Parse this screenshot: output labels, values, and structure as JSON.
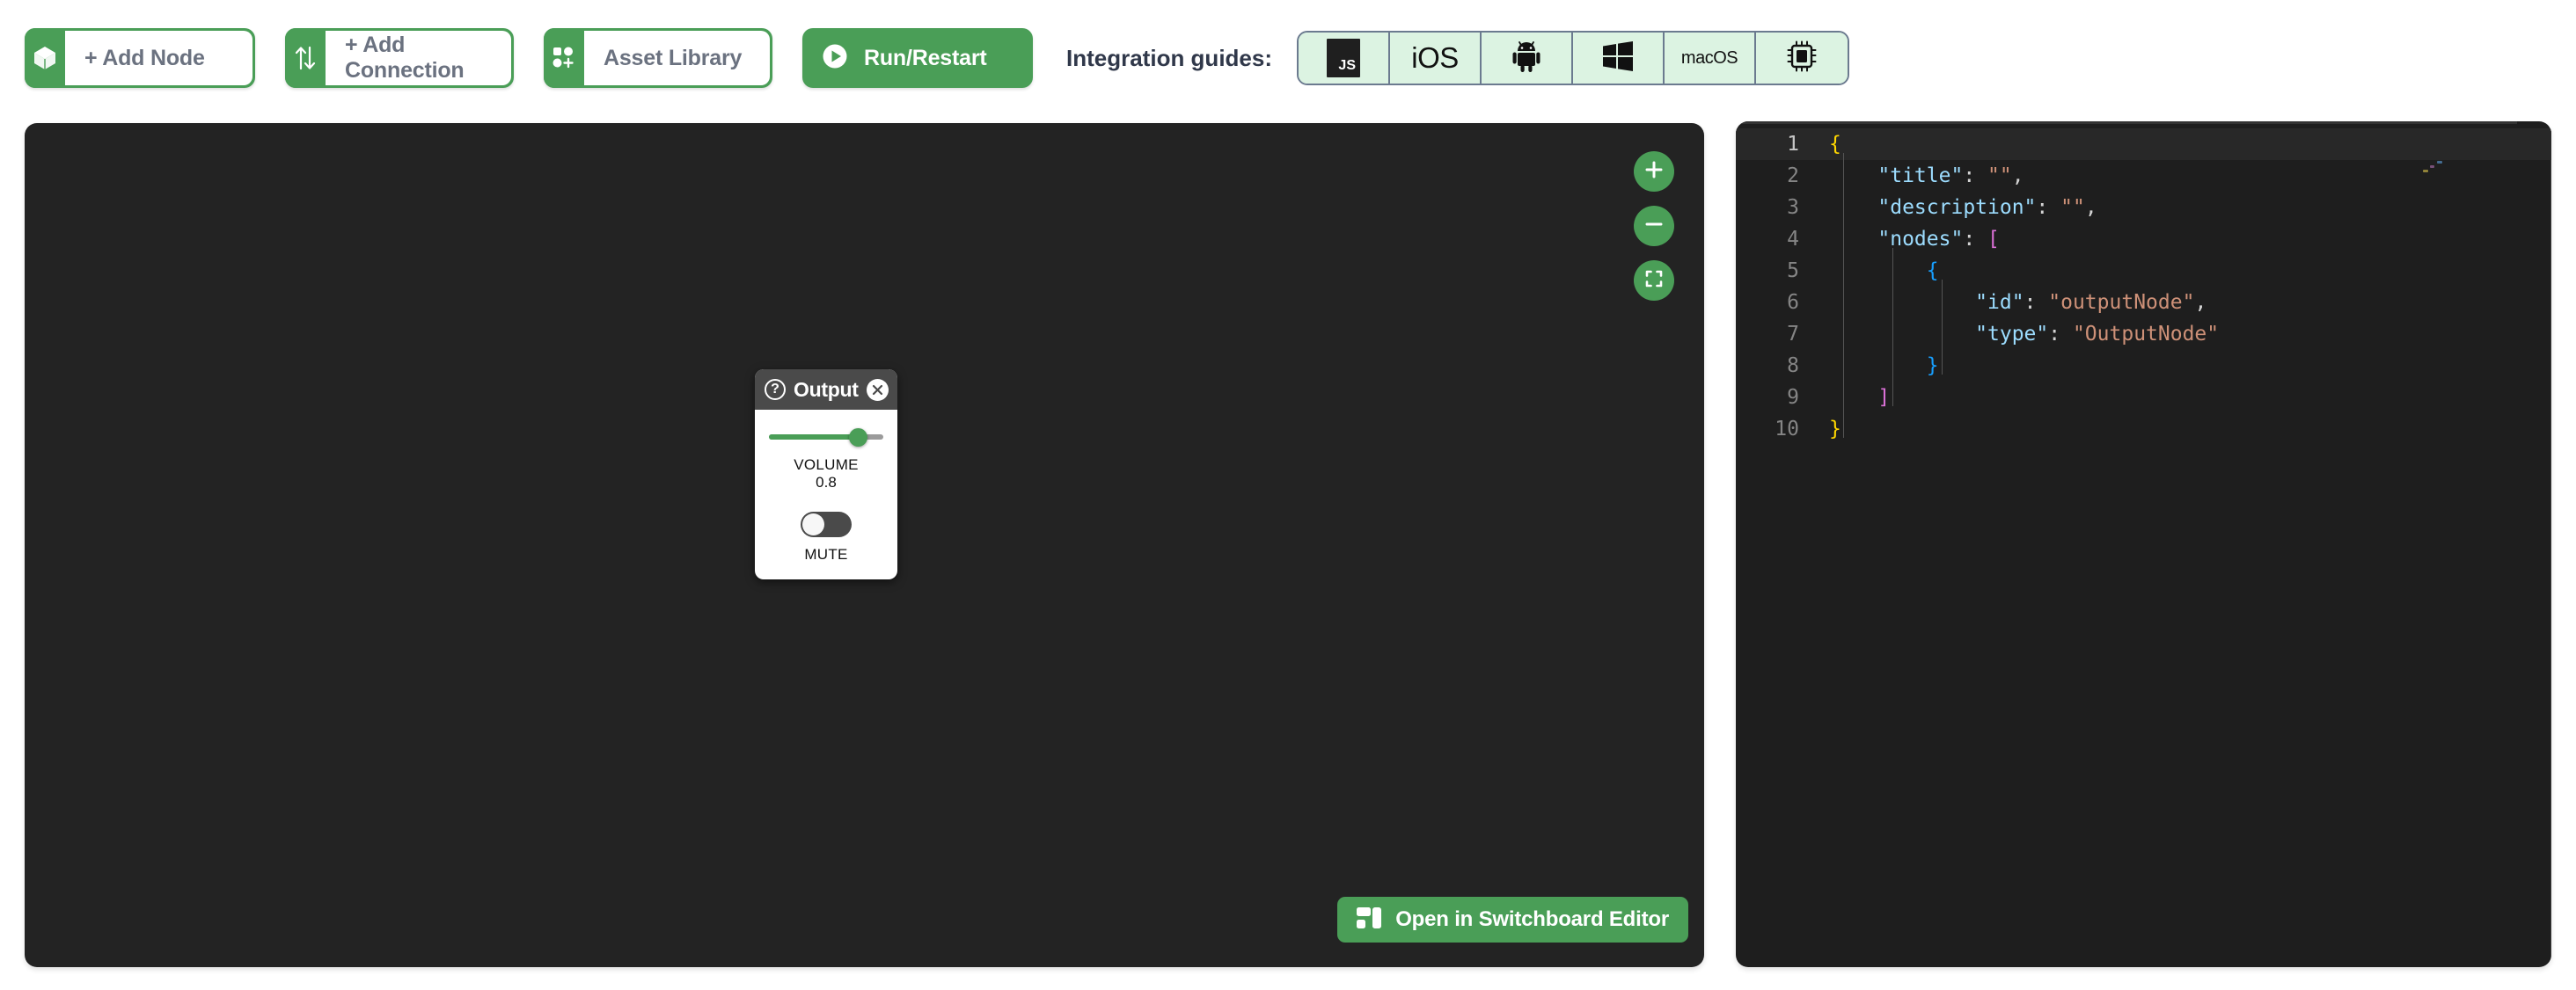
{
  "toolbar": {
    "buttons": [
      {
        "id": "add-node",
        "icon": "cube-icon",
        "label": "+ Add Node"
      },
      {
        "id": "add-connection",
        "icon": "arrows-updown-icon",
        "label": "+ Add Connection"
      },
      {
        "id": "asset-library",
        "icon": "grid-plus-icon",
        "label": "Asset Library"
      }
    ],
    "run": {
      "icon": "play-icon",
      "label": "Run/Restart"
    },
    "integration": {
      "label": "Integration guides:",
      "items": [
        {
          "id": "js",
          "type": "js-box",
          "text": "JS",
          "icon": "javascript-icon"
        },
        {
          "id": "ios",
          "type": "text",
          "text": "iOS",
          "icon": "ios-icon"
        },
        {
          "id": "android",
          "type": "glyph",
          "text": "🤖",
          "icon": "android-icon"
        },
        {
          "id": "windows",
          "type": "glyph",
          "text": "",
          "icon": "windows-icon"
        },
        {
          "id": "macos",
          "type": "text-sm",
          "text": "macOS",
          "icon": "macos-icon"
        },
        {
          "id": "embedded",
          "type": "glyph",
          "text": "",
          "icon": "cpu-chip-icon"
        }
      ]
    }
  },
  "canvas": {
    "zoom_controls": [
      {
        "id": "zoom-in",
        "icon": "plus-icon",
        "label": "+"
      },
      {
        "id": "zoom-out",
        "icon": "minus-icon",
        "label": "−"
      },
      {
        "id": "fit-view",
        "icon": "fit-frame-icon",
        "label": ""
      }
    ],
    "node": {
      "title": "Output",
      "help_icon": "question-mark-icon",
      "help_glyph": "?",
      "close_icon": "close-x-icon",
      "volume": {
        "label": "VOLUME",
        "value": "0.8",
        "fill_percent": 78
      },
      "mute": {
        "label": "MUTE",
        "state": "off"
      }
    },
    "editor_button": {
      "icon": "layout-panels-icon",
      "label": "Open in Switchboard Editor"
    }
  },
  "code_panel": {
    "language": "json",
    "active_line": 1,
    "lines": [
      {
        "n": "1",
        "tokens": [
          {
            "t": "{",
            "c": "t-brace-y"
          }
        ]
      },
      {
        "n": "2",
        "tokens": [
          {
            "t": "    \"title\"",
            "c": "t-key"
          },
          {
            "t": ": ",
            "c": "t-punc"
          },
          {
            "t": "\"\"",
            "c": "t-str"
          },
          {
            "t": ",",
            "c": "t-punc"
          }
        ]
      },
      {
        "n": "3",
        "tokens": [
          {
            "t": "    \"description\"",
            "c": "t-key"
          },
          {
            "t": ": ",
            "c": "t-punc"
          },
          {
            "t": "\"\"",
            "c": "t-str"
          },
          {
            "t": ",",
            "c": "t-punc"
          }
        ]
      },
      {
        "n": "4",
        "tokens": [
          {
            "t": "    \"nodes\"",
            "c": "t-key"
          },
          {
            "t": ": ",
            "c": "t-punc"
          },
          {
            "t": "[",
            "c": "t-brace-p"
          }
        ]
      },
      {
        "n": "5",
        "tokens": [
          {
            "t": "        {",
            "c": "t-brace-b"
          }
        ]
      },
      {
        "n": "6",
        "tokens": [
          {
            "t": "            \"id\"",
            "c": "t-key"
          },
          {
            "t": ": ",
            "c": "t-punc"
          },
          {
            "t": "\"outputNode\"",
            "c": "t-str"
          },
          {
            "t": ",",
            "c": "t-punc"
          }
        ]
      },
      {
        "n": "7",
        "tokens": [
          {
            "t": "            \"type\"",
            "c": "t-key"
          },
          {
            "t": ": ",
            "c": "t-punc"
          },
          {
            "t": "\"OutputNode\"",
            "c": "t-str"
          }
        ]
      },
      {
        "n": "8",
        "tokens": [
          {
            "t": "        }",
            "c": "t-brace-b"
          }
        ]
      },
      {
        "n": "9",
        "tokens": [
          {
            "t": "    ]",
            "c": "t-brace-p"
          }
        ]
      },
      {
        "n": "10",
        "tokens": [
          {
            "t": "}",
            "c": "t-brace-y"
          }
        ]
      }
    ]
  },
  "colors": {
    "accent_green": "#4a9e57",
    "canvas_bg": "#232323",
    "code_bg": "#1e1e1e",
    "guide_bg": "#dcf3e2",
    "guide_border": "#6b7a8f",
    "toolbar_text": "#6b7280"
  }
}
